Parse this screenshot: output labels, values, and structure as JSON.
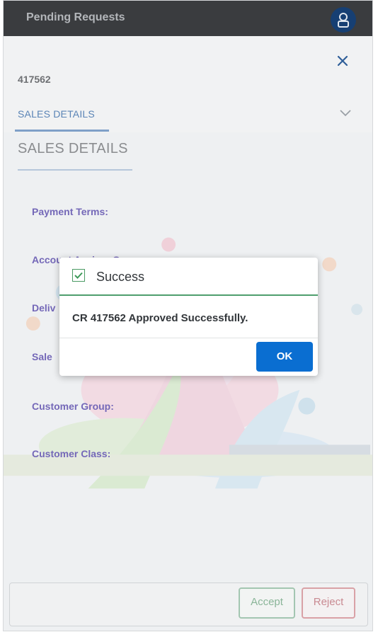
{
  "header": {
    "title": "Pending Requests",
    "user_icon": "user-icon"
  },
  "object": {
    "number": "417562",
    "tab_label": "SALES DETAILS",
    "section_title": "SALES DETAILS",
    "close_icon": "close-icon",
    "chevron_icon": "chevron-down-icon"
  },
  "fields": [
    {
      "label": "Payment Terms:"
    },
    {
      "label": "Account Assign. G"
    },
    {
      "label": "Deliv"
    },
    {
      "label": "Sale"
    },
    {
      "label": "Customer Group:"
    },
    {
      "label": "Customer Class:"
    }
  ],
  "dialog": {
    "title": "Success",
    "message": "CR 417562 Approved Successfully.",
    "ok_label": "OK",
    "status_icon": "checkbox-checked-icon"
  },
  "footer": {
    "accept_label": "Accept",
    "reject_label": "Reject"
  },
  "colors": {
    "header_bg": "#3a3c3f",
    "avatar_bg": "#163f73",
    "ok_button": "#0a6ed1",
    "success_green": "#4e9e6d",
    "field_label": "#7468b8"
  }
}
